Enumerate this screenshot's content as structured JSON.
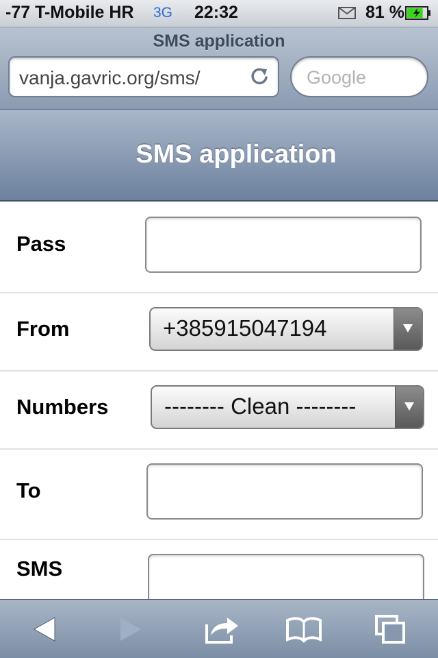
{
  "status_bar": {
    "carrier": "-77 T-Mobile HR",
    "network": "3G",
    "time": "22:32",
    "battery_pct": "81 %",
    "battery_level": 0.81,
    "battery_color": "#3bd61b"
  },
  "browser": {
    "page_title": "SMS application",
    "url": "vanja.gavric.org/sms/",
    "search_placeholder": "Google"
  },
  "page": {
    "header_title": "SMS application",
    "fields": {
      "pass_label": "Pass",
      "from_label": "From",
      "from_value": "+385915047194",
      "numbers_label": "Numbers",
      "numbers_value": "-------- Clean --------",
      "to_label": "To",
      "sms_label": "SMS"
    }
  },
  "toolbar": {
    "icons": [
      "back-icon",
      "forward-icon",
      "share-icon",
      "bookmarks-icon",
      "tabs-icon"
    ]
  }
}
